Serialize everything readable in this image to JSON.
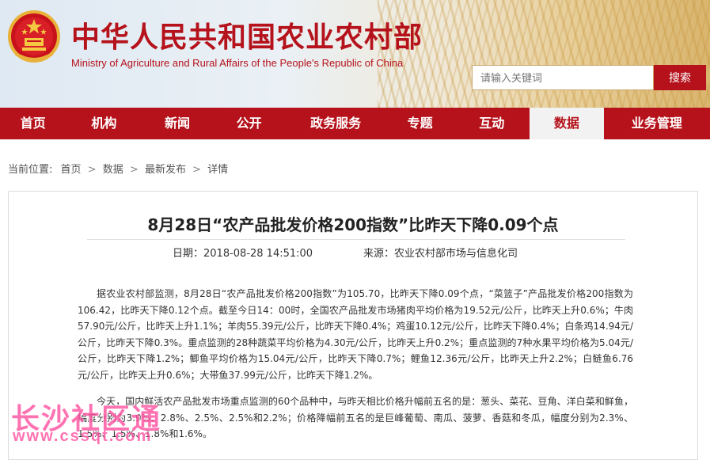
{
  "header": {
    "title_cn": "中华人民共和国农业农村部",
    "title_en": "Ministry of Agriculture and Rural Affairs of the People's Republic of China",
    "search_placeholder": "请输入关键词",
    "search_button": "搜索",
    "brand_color": "#b5121b"
  },
  "nav": {
    "items": [
      {
        "label": "首页"
      },
      {
        "label": "机构"
      },
      {
        "label": "新闻"
      },
      {
        "label": "公开"
      },
      {
        "label": "政务服务"
      },
      {
        "label": "专题"
      },
      {
        "label": "互动"
      },
      {
        "label": "数据",
        "active": true
      },
      {
        "label": "业务管理"
      }
    ]
  },
  "breadcrumb": {
    "prefix": "当前位置:",
    "items": [
      "首页",
      "数据",
      "最新发布",
      "详情"
    ],
    "separator": ">"
  },
  "article": {
    "title": "8月28日“农产品批发价格200指数”比昨天下降0.09个点",
    "date": "日期：2018-08-28 14:51:00",
    "source": "来源：农业农村部市场与信息化司",
    "paragraph1": "据农业农村部监测，8月28日“农产品批发价格200指数”为105.70，比昨天下降0.09个点，“菜篮子”产品批发价格200指数为106.42，比昨天下降0.12个点。截至今日14：00时，全国农产品批发市场猪肉平均价格为19.52元/公斤，比昨天上升0.6%；牛肉57.90元/公斤，比昨天上升1.1%；羊肉55.39元/公斤，比昨天下降0.4%；鸡蛋10.12元/公斤，比昨天下降0.4%；白条鸡14.94元/公斤，比昨天下降0.3%。重点监测的28种蔬菜平均价格为4.30元/公斤，比昨天上升0.2%；重点监测的7种水果平均价格为5.04元/公斤，比昨天下降1.2%；鲫鱼平均价格为15.04元/公斤，比昨天下降0.7%；鲤鱼12.36元/公斤，比昨天上升2.2%；白鲢鱼6.76元/公斤，比昨天上升0.6%；大带鱼37.99元/公斤，比昨天下降1.2%。",
    "paragraph2": "今天，国内鲜活农产品批发市场重点监测的60个品种中，与昨天相比价格升幅前五名的是：葱头、菜花、豆角、洋白菜和鲜鱼，幅度分别为3.9%、2.8%、2.5%、2.5%和2.2%；价格降幅前五名的是巨峰葡萄、南瓜、菠萝、香菇和冬瓜，幅度分别为2.3%、1.5%、1.5%、1.8%和1.6%。"
  },
  "watermark": {
    "cn": "长沙社区通",
    "en": "www.cssqt.com"
  }
}
